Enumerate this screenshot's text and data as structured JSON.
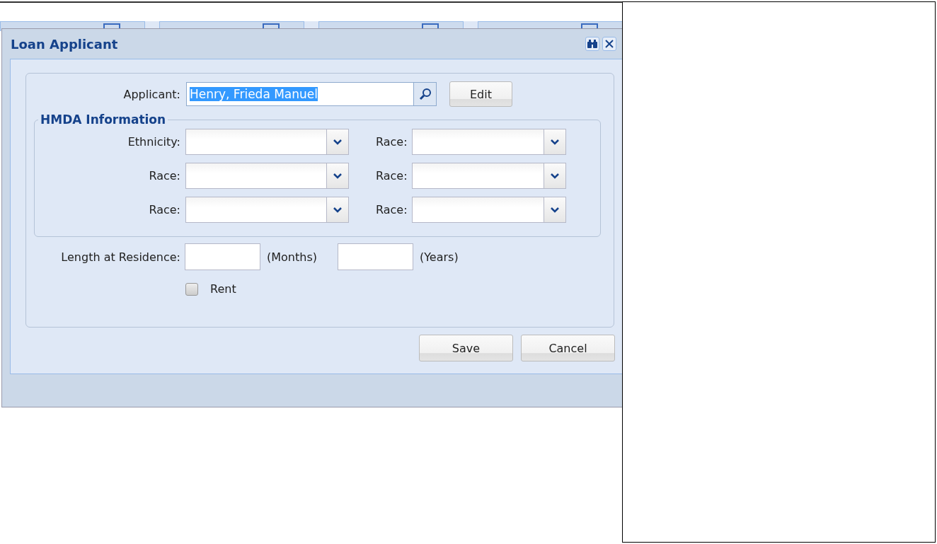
{
  "window": {
    "title": "Loan Applicant"
  },
  "applicant": {
    "label": "Applicant:",
    "value": "Henry, Frieda Manuel",
    "selected": true
  },
  "edit_button": "Edit",
  "hmda": {
    "title": "HMDA Information",
    "fields": [
      {
        "label": "Ethnicity:"
      },
      {
        "label": "Race:"
      },
      {
        "label": "Race:"
      },
      {
        "label": "Race:"
      },
      {
        "label": "Race:"
      },
      {
        "label": "Race:"
      }
    ]
  },
  "residence": {
    "label": "Length at Residence:",
    "months_unit": "(Months)",
    "years_unit": "(Years)"
  },
  "rent": {
    "label": "Rent",
    "checked": false
  },
  "buttons": [
    "Save",
    "Cancel"
  ]
}
